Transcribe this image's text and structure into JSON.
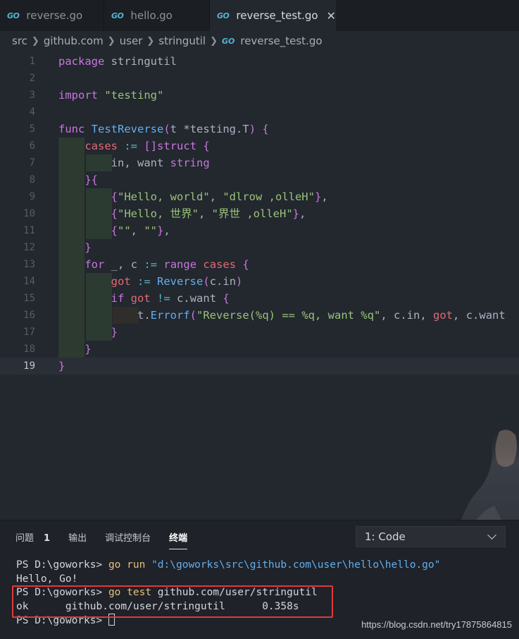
{
  "tabs": [
    {
      "label": "reverse.go",
      "icon": "go-file-icon"
    },
    {
      "label": "hello.go",
      "icon": "go-file-icon"
    },
    {
      "label": "reverse_test.go",
      "icon": "go-file-icon",
      "active": true
    }
  ],
  "tab_icon_text": "GO",
  "breadcrumb": [
    "src",
    "github.com",
    "user",
    "stringutil",
    "reverse_test.go"
  ],
  "code_lines": [
    {
      "n": "1",
      "t": "package stringutil"
    },
    {
      "n": "2",
      "t": ""
    },
    {
      "n": "3",
      "t": "import \"testing\""
    },
    {
      "n": "4",
      "t": ""
    },
    {
      "n": "5",
      "t": "func TestReverse(t *testing.T) {"
    },
    {
      "n": "6",
      "t": "    cases := []struct {"
    },
    {
      "n": "7",
      "t": "        in, want string"
    },
    {
      "n": "8",
      "t": "    }{"
    },
    {
      "n": "9",
      "t": "        {\"Hello, world\", \"dlrow ,olleH\"},"
    },
    {
      "n": "10",
      "t": "        {\"Hello, 世界\", \"界世 ,olleH\"},"
    },
    {
      "n": "11",
      "t": "        {\"\", \"\"},"
    },
    {
      "n": "12",
      "t": "    }"
    },
    {
      "n": "13",
      "t": "    for _, c := range cases {"
    },
    {
      "n": "14",
      "t": "        got := Reverse(c.in)"
    },
    {
      "n": "15",
      "t": "        if got != c.want {"
    },
    {
      "n": "16",
      "t": "            t.Errorf(\"Reverse(%q) == %q, want %q\", c.in, got, c.want"
    },
    {
      "n": "17",
      "t": "        }"
    },
    {
      "n": "18",
      "t": "    }"
    },
    {
      "n": "19",
      "t": "}"
    }
  ],
  "current_line": "19",
  "panel": {
    "tabs": [
      "问题",
      "输出",
      "调试控制台",
      "终端"
    ],
    "problems_count": "1",
    "active_tab": "终端",
    "dropdown_value": "1: Code"
  },
  "terminal": {
    "line1_prompt": "PS D:\\goworks> ",
    "line1_cmd": "go run ",
    "line1_arg": "\"d:\\goworks\\src\\github.com\\user\\hello\\hello.go\"",
    "line2": "Hello, Go!",
    "line3_prompt": "PS D:\\goworks> ",
    "line3_cmd": "go test ",
    "line3_arg": "github.com/user/stringutil",
    "line4": "ok      github.com/user/stringutil      0.358s",
    "line5_prompt": "PS D:\\goworks> "
  },
  "watermark": "https://blog.csdn.net/try17875864815",
  "colors": {
    "keyword": "#c678dd",
    "function": "#61afef",
    "string": "#98c379",
    "variable": "#e06c75",
    "highlight_box": "#e03a3a"
  }
}
